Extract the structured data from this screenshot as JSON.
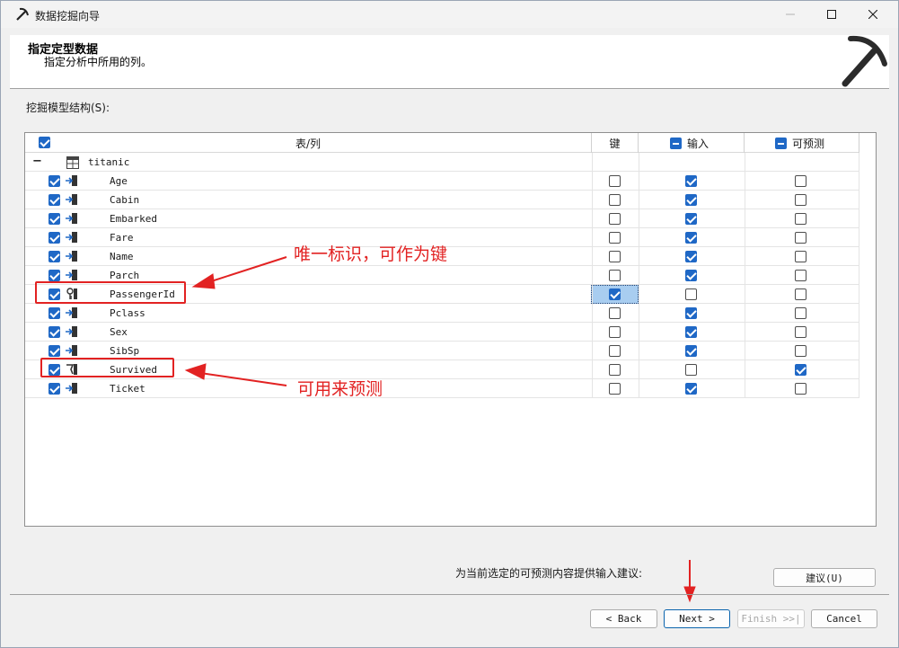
{
  "window": {
    "title": "数据挖掘向导"
  },
  "header": {
    "title": "指定定型数据",
    "subtitle": "指定分析中所用的列。"
  },
  "section_label": "挖掘模型结构(S):",
  "grid": {
    "columns": {
      "table_col": "表/列",
      "key": "键",
      "input": "输入",
      "predictable": "可预测"
    },
    "table_name": "titanic",
    "rows": [
      {
        "name": "Age",
        "checked": true,
        "key": false,
        "input": true,
        "predict": false,
        "icon": "input-column-icon"
      },
      {
        "name": "Cabin",
        "checked": true,
        "key": false,
        "input": true,
        "predict": false,
        "icon": "input-column-icon"
      },
      {
        "name": "Embarked",
        "checked": true,
        "key": false,
        "input": true,
        "predict": false,
        "icon": "input-column-icon"
      },
      {
        "name": "Fare",
        "checked": true,
        "key": false,
        "input": true,
        "predict": false,
        "icon": "input-column-icon"
      },
      {
        "name": "Name",
        "checked": true,
        "key": false,
        "input": true,
        "predict": false,
        "icon": "input-column-icon"
      },
      {
        "name": "Parch",
        "checked": true,
        "key": false,
        "input": true,
        "predict": false,
        "icon": "input-column-icon"
      },
      {
        "name": "PassengerId",
        "checked": true,
        "key": true,
        "input": false,
        "predict": false,
        "icon": "key-column-icon"
      },
      {
        "name": "Pclass",
        "checked": true,
        "key": false,
        "input": true,
        "predict": false,
        "icon": "input-column-icon"
      },
      {
        "name": "Sex",
        "checked": true,
        "key": false,
        "input": true,
        "predict": false,
        "icon": "input-column-icon"
      },
      {
        "name": "SibSp",
        "checked": true,
        "key": false,
        "input": true,
        "predict": false,
        "icon": "input-column-icon"
      },
      {
        "name": "Survived",
        "checked": true,
        "key": false,
        "input": false,
        "predict": true,
        "icon": "predict-column-icon"
      },
      {
        "name": "Ticket",
        "checked": true,
        "key": false,
        "input": true,
        "predict": false,
        "icon": "input-column-icon"
      }
    ]
  },
  "annotations": {
    "key_note": "唯一标识，可作为键",
    "predict_note": "可用来预测"
  },
  "suggest_text": "为当前选定的可预测内容提供输入建议:",
  "buttons": {
    "suggest": "建议(U)",
    "back": "< Back",
    "next": "Next >",
    "finish": "Finish >>|",
    "cancel": "Cancel"
  },
  "colors": {
    "accent": "#1f68c6",
    "annotation": "#e22222",
    "selection": "#a8cdf0"
  }
}
